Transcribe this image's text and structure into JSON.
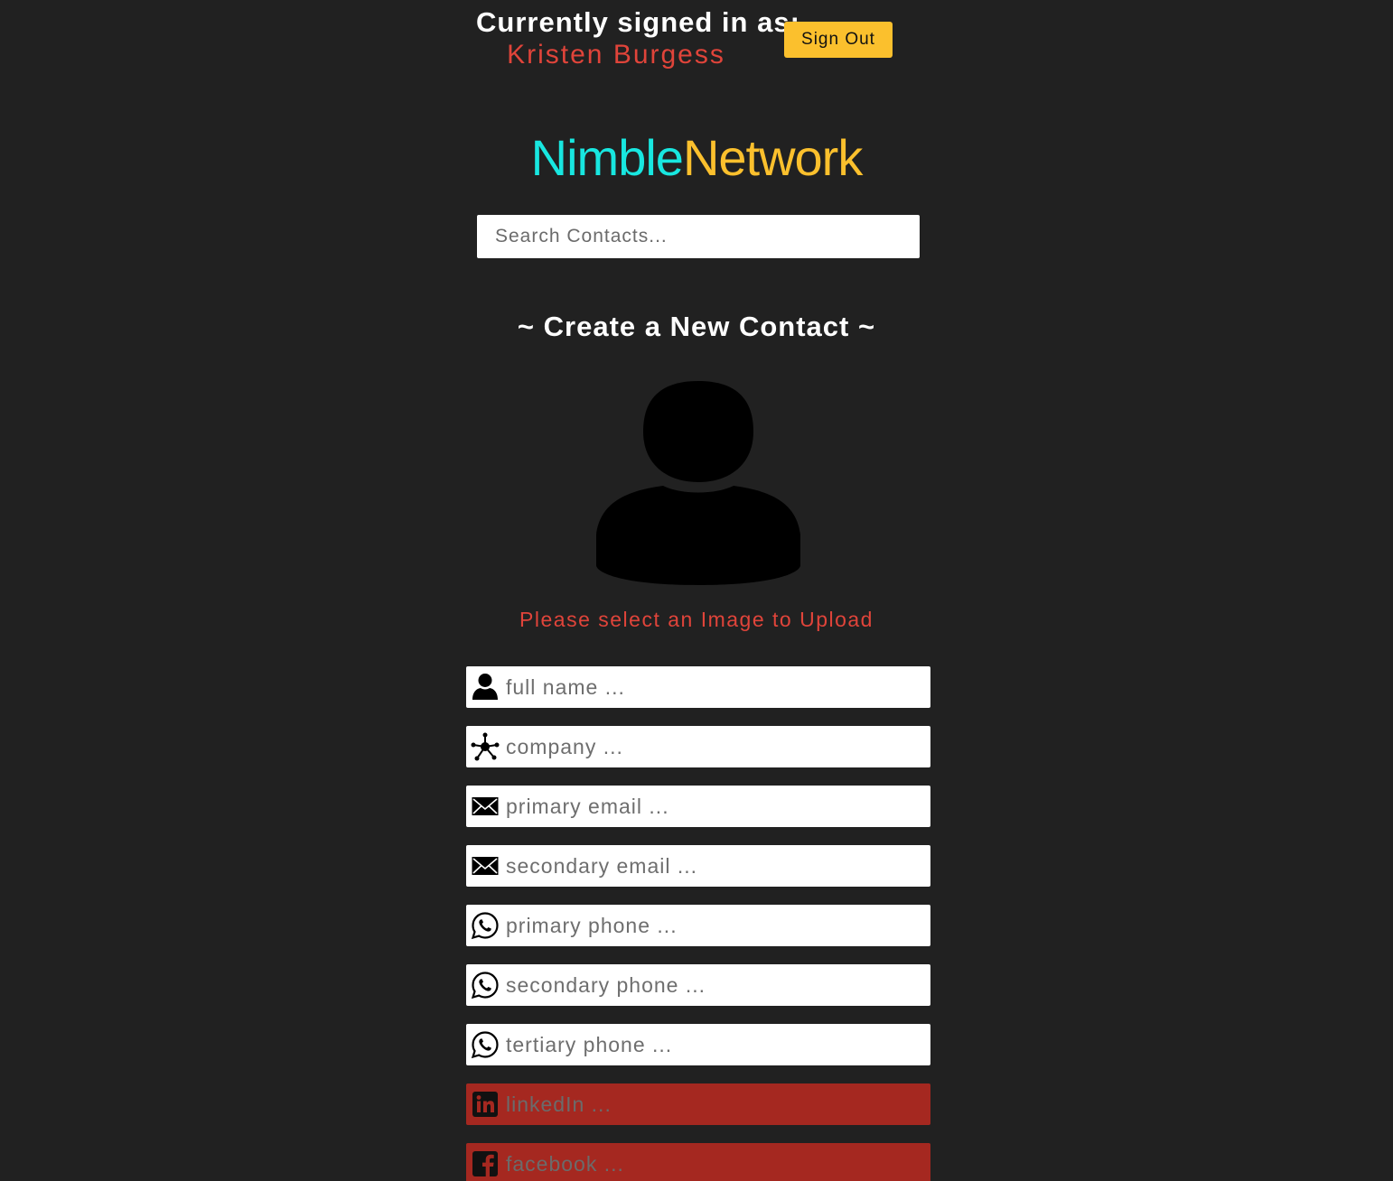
{
  "header": {
    "signed_in_label": "Currently signed in as:",
    "user_name": "Kristen Burgess",
    "sign_out_label": "Sign Out"
  },
  "logo": {
    "part1": "Nimble",
    "part2": "Network"
  },
  "search": {
    "placeholder": "Search Contacts..."
  },
  "form": {
    "title": "~ Create a New Contact ~",
    "avatar_icon": "user-silhouette-icon",
    "upload_prompt": "Please select an Image to Upload",
    "fields": [
      {
        "icon": "user-icon",
        "placeholder": "full name ..."
      },
      {
        "icon": "network-icon",
        "placeholder": "company ..."
      },
      {
        "icon": "envelope-icon",
        "placeholder": "primary email ..."
      },
      {
        "icon": "envelope-icon",
        "placeholder": "secondary email ..."
      },
      {
        "icon": "whatsapp-phone-icon",
        "placeholder": "primary phone ..."
      },
      {
        "icon": "whatsapp-phone-icon",
        "placeholder": "secondary phone ..."
      },
      {
        "icon": "whatsapp-phone-icon",
        "placeholder": "tertiary phone ..."
      },
      {
        "icon": "linkedin-icon",
        "placeholder": "linkedIn ..."
      },
      {
        "icon": "facebook-icon",
        "placeholder": "facebook ..."
      }
    ]
  },
  "colors": {
    "background": "#212121",
    "accent_cyan": "#18e7e0",
    "accent_yellow": "#fbc02d",
    "accent_red": "#e0443a",
    "social_field_bg": "#a52820"
  }
}
